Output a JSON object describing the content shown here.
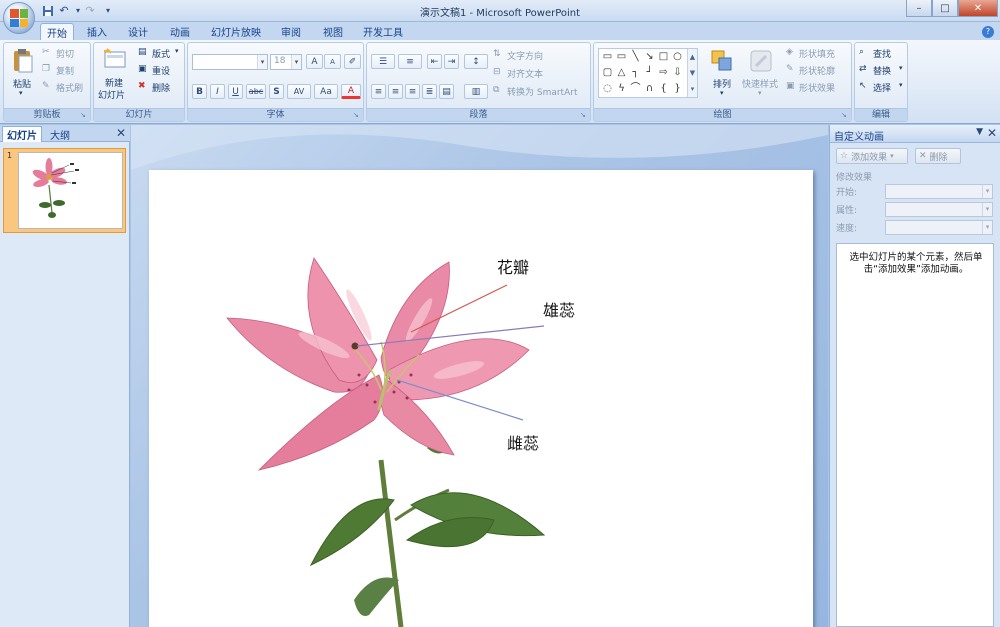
{
  "window": {
    "title": "演示文稿1 - Microsoft PowerPoint",
    "controls": {
      "minimize": "–",
      "maximize": "□",
      "close": "✕"
    }
  },
  "quick_access": {
    "icons": [
      "save-icon",
      "undo-icon",
      "redo-icon",
      "customize-icon"
    ],
    "undo": "↶",
    "redo": "↷",
    "save": "▪",
    "customize": "▾"
  },
  "tabs": [
    {
      "label": "开始",
      "active": true
    },
    {
      "label": "插入"
    },
    {
      "label": "设计"
    },
    {
      "label": "动画"
    },
    {
      "label": "幻灯片放映"
    },
    {
      "label": "审阅"
    },
    {
      "label": "视图"
    },
    {
      "label": "开发工具"
    }
  ],
  "ribbon": {
    "clipboard": {
      "label": "剪贴板",
      "paste": "粘贴",
      "cut": "剪切",
      "copy": "复制",
      "format_painter": "格式刷"
    },
    "slides": {
      "label": "幻灯片",
      "new_slide_1": "新建",
      "new_slide_2": "幻灯片",
      "layout": "版式",
      "reset": "重设",
      "delete": "删除"
    },
    "font": {
      "label": "字体",
      "font_name": "",
      "font_size": "18",
      "grow": "A",
      "shrink": "A",
      "bold": "B",
      "italic": "I",
      "underline": "U",
      "strike": "abc",
      "shadow": "S",
      "spacing": "AV",
      "case": "Aa",
      "color": "A"
    },
    "paragraph": {
      "label": "段落",
      "text_direction": "文字方向",
      "align_text": "对齐文本",
      "smartart": "转换为 SmartArt"
    },
    "drawing": {
      "label": "绘图",
      "arrange": "排列",
      "quick_styles": "快速样式",
      "shape_fill": "形状填充",
      "shape_outline": "形状轮廓",
      "shape_effects": "形状效果"
    },
    "editing": {
      "label": "编辑",
      "find": "查找",
      "replace": "替换",
      "select": "选择"
    }
  },
  "left_panel": {
    "tabs": [
      {
        "label": "幻灯片",
        "active": true
      },
      {
        "label": "大纲"
      }
    ],
    "close": "✕",
    "thumbnail_number": "1"
  },
  "slide": {
    "labels": {
      "petal": "花瓣",
      "stamen": "雄蕊",
      "pistil": "雌蕊"
    }
  },
  "task_pane": {
    "title": "自定义动画",
    "add_effect": "添加效果",
    "remove": "删除",
    "modify": "修改效果",
    "start": "开始:",
    "property": "属性:",
    "speed": "速度:",
    "hint": "选中幻灯片的某个元素，然后单击“添加效果”添加动画。"
  },
  "colors": {
    "accent": "#15428b",
    "ribbon_bg": "#dde8f5",
    "thumb_selected": "#f9c780",
    "callout_red": "#d9534f",
    "callout_purple": "#8c7ab8",
    "callout_blue": "#7b8fc7"
  }
}
